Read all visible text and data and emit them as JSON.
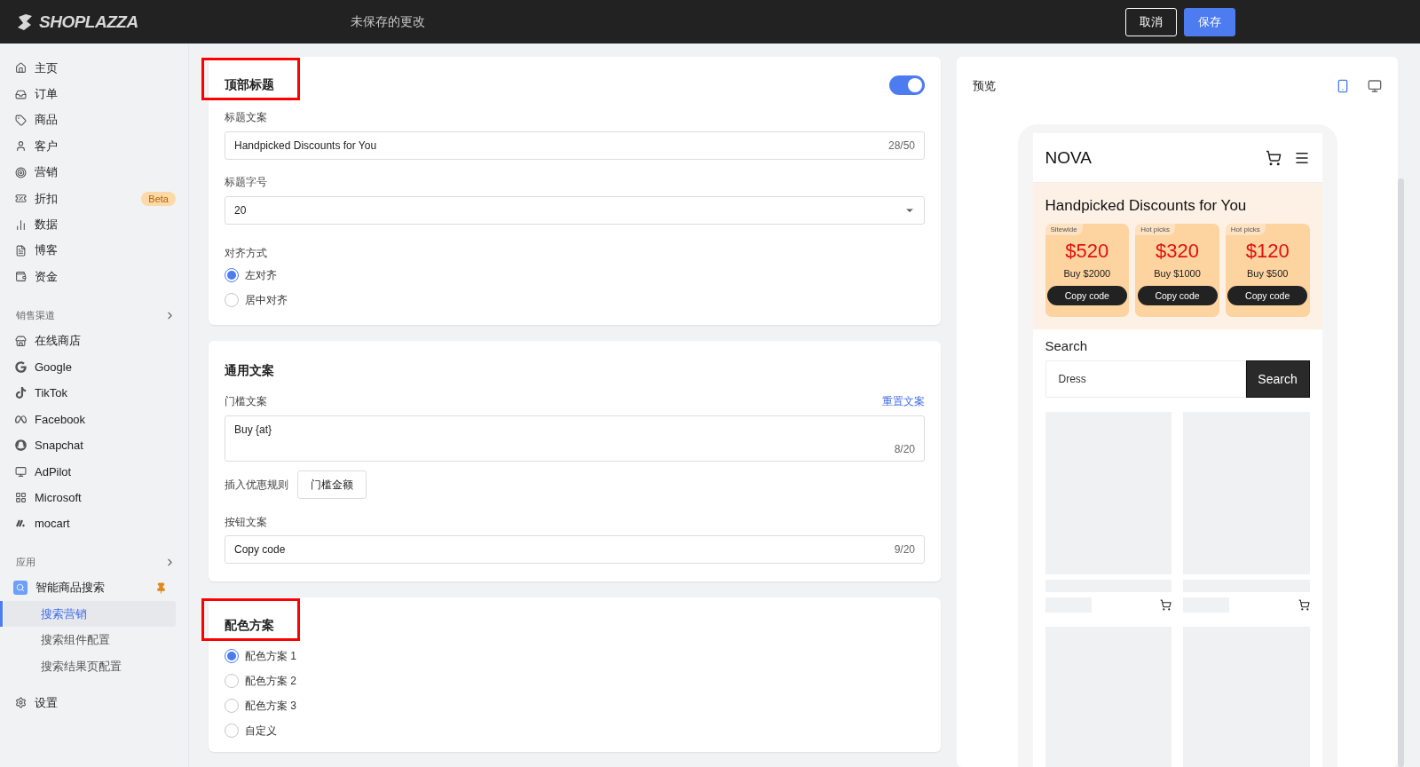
{
  "topbar": {
    "logo": "SHOPLAZZA",
    "status": "未保存的更改",
    "buttons": [
      {
        "label": "取消",
        "kind": "secondary"
      },
      {
        "label": "保存",
        "kind": "primary"
      }
    ]
  },
  "sidebar": {
    "main_items": [
      {
        "label": "主页"
      },
      {
        "label": "订单"
      },
      {
        "label": "商品"
      },
      {
        "label": "客户"
      },
      {
        "label": "营销"
      },
      {
        "label": "折扣",
        "badge": "Beta"
      },
      {
        "label": "数据"
      },
      {
        "label": "博客"
      },
      {
        "label": "资金"
      }
    ],
    "channels_header": "销售渠道",
    "channels": [
      {
        "label": "在线商店"
      },
      {
        "label": "Google"
      },
      {
        "label": "TikTok"
      },
      {
        "label": "Facebook"
      },
      {
        "label": "Snapchat"
      },
      {
        "label": "AdPilot"
      },
      {
        "label": "Microsoft"
      },
      {
        "label": "mocart"
      }
    ],
    "apps_header": "应用",
    "app": {
      "label": "智能商品搜索",
      "pinned": true,
      "children": [
        {
          "label": "搜索营销",
          "selected": true
        },
        {
          "label": "搜索组件配置",
          "selected": false
        },
        {
          "label": "搜索结果页配置",
          "selected": false
        }
      ]
    },
    "settings": "设置"
  },
  "header_card": {
    "title": "顶部标题",
    "highlighted": true,
    "enabled": true,
    "title_text": {
      "label": "标题文案",
      "value": "Handpicked Discounts for You",
      "counter": "28/50"
    },
    "font_size": {
      "label": "标题字号",
      "value": "20"
    },
    "alignment": {
      "label": "对齐方式",
      "options": [
        {
          "label": "左对齐",
          "selected": true
        },
        {
          "label": "居中对齐",
          "selected": false
        }
      ]
    }
  },
  "copy_card": {
    "title": "通用文案",
    "threshold": {
      "label": "门槛文案",
      "reset_link": "重置文案",
      "value": "Buy {at}",
      "counter": "8/20"
    },
    "insert": {
      "label": "插入优惠规则",
      "button": "门槛金额"
    },
    "button_text": {
      "label": "按钮文案",
      "value": "Copy code",
      "counter": "9/20"
    }
  },
  "color_card": {
    "title": "配色方案",
    "highlighted": true,
    "options": [
      {
        "label": "配色方案 1",
        "selected": true
      },
      {
        "label": "配色方案 2",
        "selected": false
      },
      {
        "label": "配色方案 3",
        "selected": false
      },
      {
        "label": "自定义",
        "selected": false
      }
    ]
  },
  "preview": {
    "title": "预览",
    "devices": [
      {
        "kind": "mobile",
        "selected": true
      },
      {
        "kind": "desktop",
        "selected": false
      }
    ],
    "store_name": "NOVA",
    "banner_title": "Handpicked Discounts for You",
    "coupons": [
      {
        "tag": "Sitewide",
        "amount": "$520",
        "condition": "Buy $2000",
        "button": "Copy code"
      },
      {
        "tag": "Hot picks",
        "amount": "$320",
        "condition": "Buy $1000",
        "button": "Copy code"
      },
      {
        "tag": "Hot picks",
        "amount": "$120",
        "condition": "Buy $500",
        "button": "Copy code"
      }
    ],
    "search_label": "Search",
    "search_value": "Dress",
    "search_button": "Search"
  }
}
